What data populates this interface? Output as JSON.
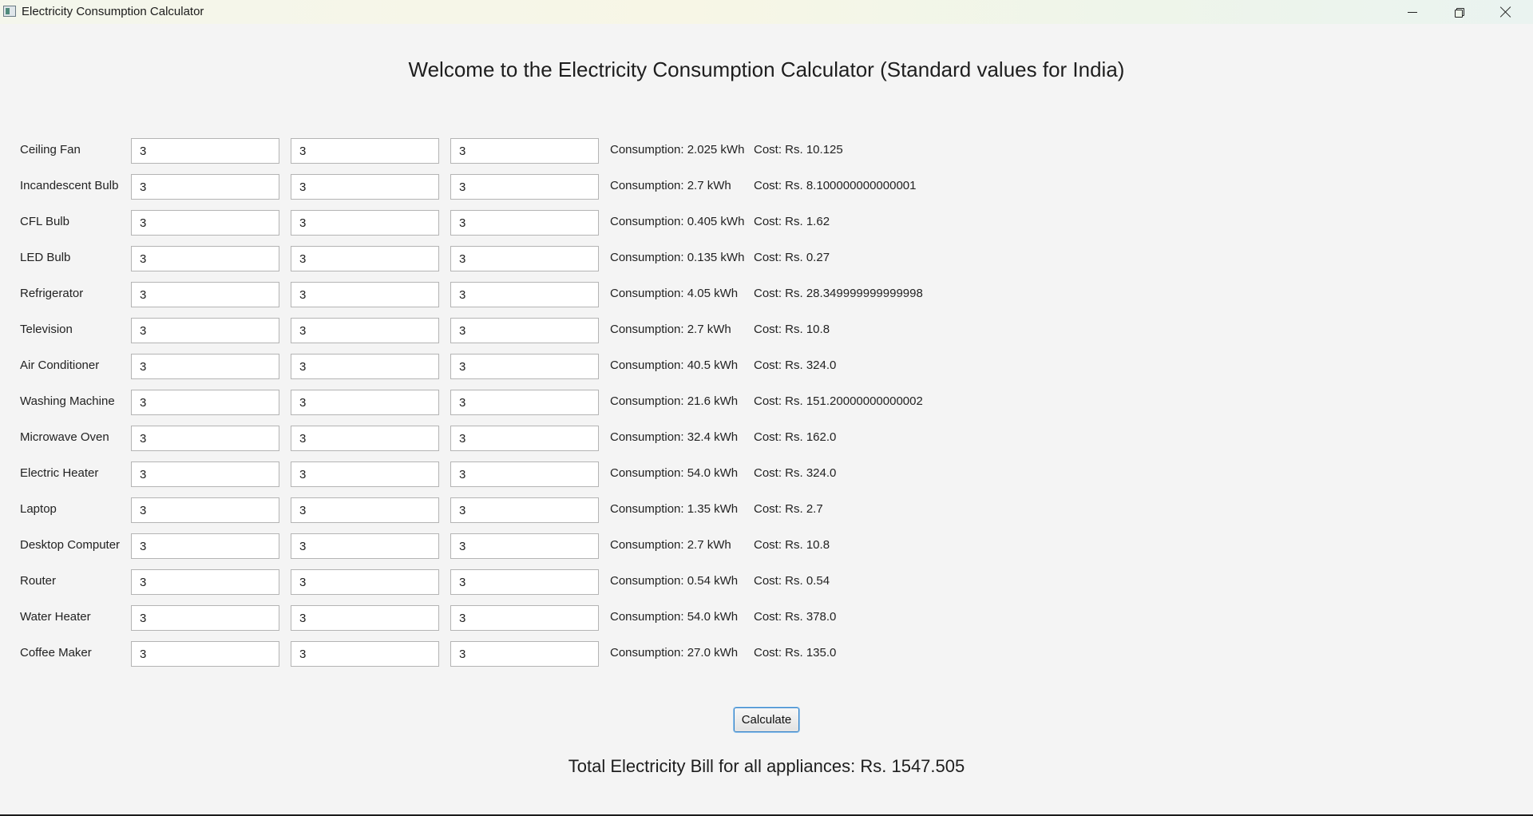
{
  "window": {
    "title": "Electricity Consumption Calculator",
    "controls": [
      "minimize",
      "restore",
      "close"
    ]
  },
  "heading": "Welcome to the Electricity Consumption Calculator (Standard values for India)",
  "appliances": [
    {
      "name": "Ceiling Fan",
      "inputs": [
        "3",
        "3",
        "3"
      ],
      "consumption": "Consumption: 2.025 kWh",
      "cost": "Cost: Rs. 10.125"
    },
    {
      "name": "Incandescent Bulb",
      "inputs": [
        "3",
        "3",
        "3"
      ],
      "consumption": "Consumption: 2.7 kWh",
      "cost": "Cost: Rs. 8.100000000000001"
    },
    {
      "name": "CFL Bulb",
      "inputs": [
        "3",
        "3",
        "3"
      ],
      "consumption": "Consumption: 0.405 kWh",
      "cost": "Cost: Rs. 1.62"
    },
    {
      "name": "LED Bulb",
      "inputs": [
        "3",
        "3",
        "3"
      ],
      "consumption": "Consumption: 0.135 kWh",
      "cost": "Cost: Rs. 0.27"
    },
    {
      "name": "Refrigerator",
      "inputs": [
        "3",
        "3",
        "3"
      ],
      "consumption": "Consumption: 4.05 kWh",
      "cost": "Cost: Rs. 28.349999999999998"
    },
    {
      "name": "Television",
      "inputs": [
        "3",
        "3",
        "3"
      ],
      "consumption": "Consumption: 2.7 kWh",
      "cost": "Cost: Rs. 10.8"
    },
    {
      "name": "Air Conditioner",
      "inputs": [
        "3",
        "3",
        "3"
      ],
      "consumption": "Consumption: 40.5 kWh",
      "cost": "Cost: Rs. 324.0"
    },
    {
      "name": "Washing Machine",
      "inputs": [
        "3",
        "3",
        "3"
      ],
      "consumption": "Consumption: 21.6 kWh",
      "cost": "Cost: Rs. 151.20000000000002"
    },
    {
      "name": "Microwave Oven",
      "inputs": [
        "3",
        "3",
        "3"
      ],
      "consumption": "Consumption: 32.4 kWh",
      "cost": "Cost: Rs. 162.0"
    },
    {
      "name": "Electric Heater",
      "inputs": [
        "3",
        "3",
        "3"
      ],
      "consumption": "Consumption: 54.0 kWh",
      "cost": "Cost: Rs. 324.0"
    },
    {
      "name": "Laptop",
      "inputs": [
        "3",
        "3",
        "3"
      ],
      "consumption": "Consumption: 1.35 kWh",
      "cost": "Cost: Rs. 2.7"
    },
    {
      "name": "Desktop Computer",
      "inputs": [
        "3",
        "3",
        "3"
      ],
      "consumption": "Consumption: 2.7 kWh",
      "cost": "Cost: Rs. 10.8"
    },
    {
      "name": "Router",
      "inputs": [
        "3",
        "3",
        "3"
      ],
      "consumption": "Consumption: 0.54 kWh",
      "cost": "Cost: Rs. 0.54"
    },
    {
      "name": "Water Heater",
      "inputs": [
        "3",
        "3",
        "3"
      ],
      "consumption": "Consumption: 54.0 kWh",
      "cost": "Cost: Rs. 378.0"
    },
    {
      "name": "Coffee Maker",
      "inputs": [
        "3",
        "3",
        "3"
      ],
      "consumption": "Consumption: 27.0 kWh",
      "cost": "Cost: Rs. 135.0"
    }
  ],
  "calculate_label": "Calculate",
  "total": "Total Electricity Bill for all appliances: Rs. 1547.505",
  "colors": {
    "background": "#f4f4f4",
    "button_focus_border": "#2f7fc6"
  }
}
